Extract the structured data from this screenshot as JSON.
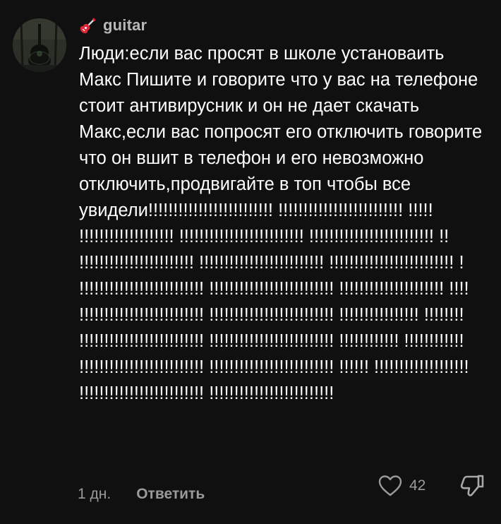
{
  "comment": {
    "username": "guitar",
    "user_icon": "guitar-icon",
    "avatar_icon": "guitar-photo-avatar",
    "text": "Люди:если вас просят в школе установаить Макс Пишите и говорите что у вас на телефоне стоит антивирусник и он не дает скачать Макс,если вас попросят его отключить говорите что он вшит в телефон и его невозможно отключить,продвигайте в топ чтобы все увидели!!!!!!!!!!!!!!!!!!!!!!!!! !!!!!!!!!!!!!!!!!!!!!!!!! !!!!! !!!!!!!!!!!!!!!!!!! !!!!!!!!!!!!!!!!!!!!!!!!! !!!!!!!!!!!!!!!!!!!!!!!!! !! !!!!!!!!!!!!!!!!!!!!!!! !!!!!!!!!!!!!!!!!!!!!!!!! !!!!!!!!!!!!!!!!!!!!!!!!! ! !!!!!!!!!!!!!!!!!!!!!!!!! !!!!!!!!!!!!!!!!!!!!!!!!! !!!!!!!!!!!!!!!!!!!!! !!!! !!!!!!!!!!!!!!!!!!!!!!!!! !!!!!!!!!!!!!!!!!!!!!!!!! !!!!!!!!!!!!!!!! !!!!!!!! !!!!!!!!!!!!!!!!!!!!!!!!! !!!!!!!!!!!!!!!!!!!!!!!!! !!!!!!!!!!!! !!!!!!!!!!!! !!!!!!!!!!!!!!!!!!!!!!!!! !!!!!!!!!!!!!!!!!!!!!!!!! !!!!!! !!!!!!!!!!!!!!!!!!! !!!!!!!!!!!!!!!!!!!!!!!!! !!!!!!!!!!!!!!!!!!!!!!!!!",
    "time": "1 дн.",
    "reply_label": "Ответить",
    "like_count": "42",
    "like_icon": "heart-outline-icon",
    "dislike_icon": "thumbs-down-outline-icon"
  },
  "colors": {
    "background": "#101010",
    "text": "#ffffff",
    "muted": "#9a9a9a",
    "username": "#b8b8b8",
    "guitar_icon_red": "#e0263a"
  }
}
